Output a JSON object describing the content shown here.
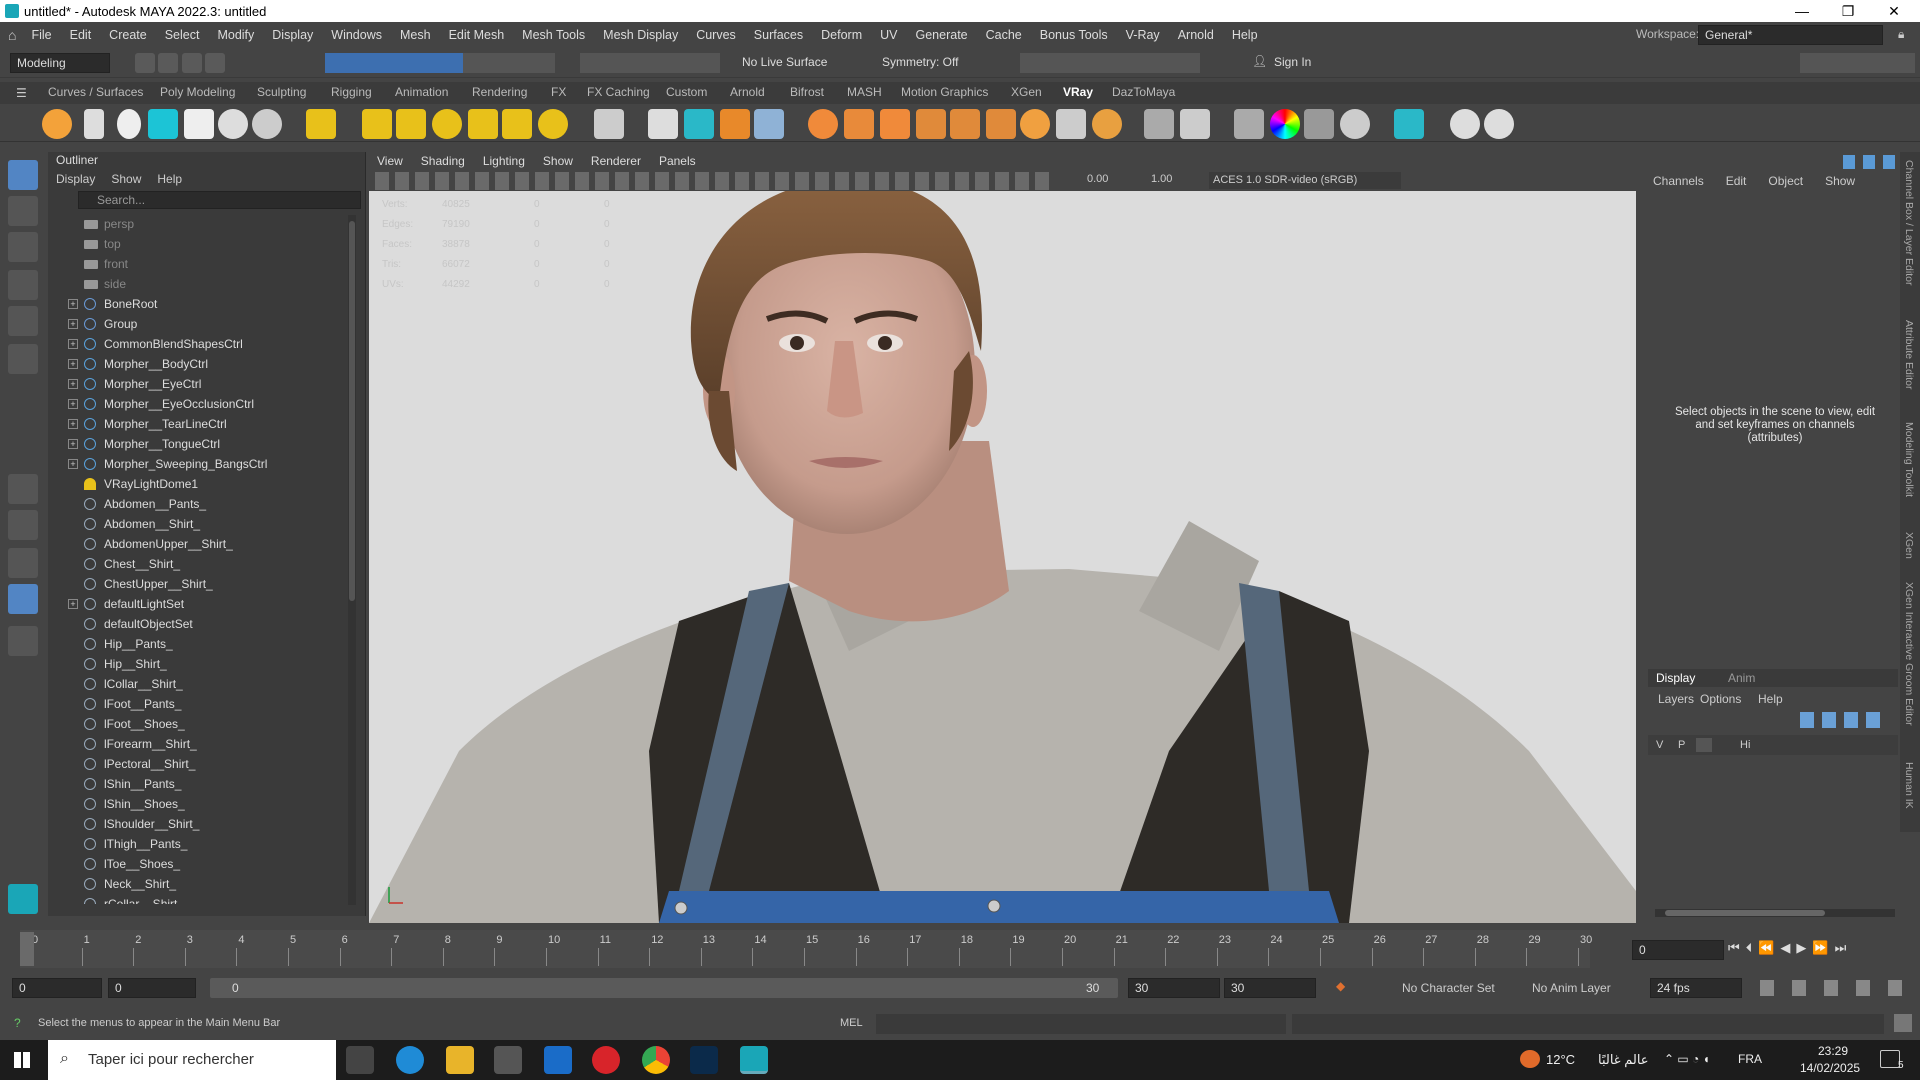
{
  "window": {
    "title": "untitled* - Autodesk MAYA 2022.3: untitled"
  },
  "menubar": {
    "items": [
      "File",
      "Edit",
      "Create",
      "Select",
      "Modify",
      "Display",
      "Windows",
      "Mesh",
      "Edit Mesh",
      "Mesh Tools",
      "Mesh Display",
      "Curves",
      "Surfaces",
      "Deform",
      "UV",
      "Generate",
      "Cache",
      "Bonus Tools",
      "V-Ray",
      "Arnold",
      "Help"
    ],
    "workspace_label": "Workspace:",
    "workspace_value": "General*"
  },
  "statusline": {
    "mode": "Modeling",
    "live_surface": "No Live Surface",
    "symmetry": "Symmetry: Off",
    "sign_in": "Sign In"
  },
  "shelf": {
    "tabs": [
      "Curves / Surfaces",
      "Poly Modeling",
      "Sculpting",
      "Rigging",
      "Animation",
      "Rendering",
      "FX",
      "FX Caching",
      "Custom",
      "Arnold",
      "Bifrost",
      "MASH",
      "Motion Graphics",
      "XGen",
      "VRay",
      "DazToMaya"
    ],
    "active_tab": "VRay"
  },
  "outliner": {
    "title": "Outliner",
    "menu": [
      "Display",
      "Show",
      "Help"
    ],
    "search_placeholder": "Search...",
    "items": [
      {
        "label": "persp",
        "type": "cam",
        "expand": ""
      },
      {
        "label": "top",
        "type": "cam",
        "expand": ""
      },
      {
        "label": "front",
        "type": "cam",
        "expand": ""
      },
      {
        "label": "side",
        "type": "cam",
        "expand": ""
      },
      {
        "label": "BoneRoot",
        "type": "joint",
        "expand": "+"
      },
      {
        "label": "Group",
        "type": "joint",
        "expand": "+"
      },
      {
        "label": "CommonBlendShapesCtrl",
        "type": "curve",
        "expand": "+"
      },
      {
        "label": "Morpher__BodyCtrl",
        "type": "curve",
        "expand": "+"
      },
      {
        "label": "Morpher__EyeCtrl",
        "type": "curve",
        "expand": "+"
      },
      {
        "label": "Morpher__EyeOcclusionCtrl",
        "type": "curve",
        "expand": "+"
      },
      {
        "label": "Morpher__TearLineCtrl",
        "type": "curve",
        "expand": "+"
      },
      {
        "label": "Morpher__TongueCtrl",
        "type": "curve",
        "expand": "+"
      },
      {
        "label": "Morpher_Sweeping_BangsCtrl",
        "type": "curve",
        "expand": "+"
      },
      {
        "label": "VRayLightDome1",
        "type": "light",
        "expand": ""
      },
      {
        "label": "Abdomen__Pants_",
        "type": "set",
        "expand": ""
      },
      {
        "label": "Abdomen__Shirt_",
        "type": "set",
        "expand": ""
      },
      {
        "label": "AbdomenUpper__Shirt_",
        "type": "set",
        "expand": ""
      },
      {
        "label": "Chest__Shirt_",
        "type": "set",
        "expand": ""
      },
      {
        "label": "ChestUpper__Shirt_",
        "type": "set",
        "expand": ""
      },
      {
        "label": "defaultLightSet",
        "type": "set",
        "expand": "+"
      },
      {
        "label": "defaultObjectSet",
        "type": "set",
        "expand": ""
      },
      {
        "label": "Hip__Pants_",
        "type": "set",
        "expand": ""
      },
      {
        "label": "Hip__Shirt_",
        "type": "set",
        "expand": ""
      },
      {
        "label": "lCollar__Shirt_",
        "type": "set",
        "expand": ""
      },
      {
        "label": "lFoot__Pants_",
        "type": "set",
        "expand": ""
      },
      {
        "label": "lFoot__Shoes_",
        "type": "set",
        "expand": ""
      },
      {
        "label": "lForearm__Shirt_",
        "type": "set",
        "expand": ""
      },
      {
        "label": "lPectoral__Shirt_",
        "type": "set",
        "expand": ""
      },
      {
        "label": "lShin__Pants_",
        "type": "set",
        "expand": ""
      },
      {
        "label": "lShin__Shoes_",
        "type": "set",
        "expand": ""
      },
      {
        "label": "lShoulder__Shirt_",
        "type": "set",
        "expand": ""
      },
      {
        "label": "lThigh__Pants_",
        "type": "set",
        "expand": ""
      },
      {
        "label": "lToe__Shoes_",
        "type": "set",
        "expand": ""
      },
      {
        "label": "Neck__Shirt_",
        "type": "set",
        "expand": ""
      },
      {
        "label": "rCollar__Shirt",
        "type": "set",
        "expand": ""
      }
    ]
  },
  "viewport": {
    "menu": [
      "View",
      "Shading",
      "Lighting",
      "Show",
      "Renderer",
      "Panels"
    ],
    "gamma": "0.00",
    "exposure": "1.00",
    "colorspace": "ACES 1.0 SDR-video (sRGB)",
    "hud": [
      {
        "label": "Verts:",
        "a": "40825",
        "b": "0",
        "c": "0"
      },
      {
        "label": "Edges:",
        "a": "79190",
        "b": "0",
        "c": "0"
      },
      {
        "label": "Faces:",
        "a": "38878",
        "b": "0",
        "c": "0"
      },
      {
        "label": "Tris:",
        "a": "66072",
        "b": "0",
        "c": "0"
      },
      {
        "label": "UVs:",
        "a": "44292",
        "b": "0",
        "c": "0"
      }
    ]
  },
  "channelbox": {
    "menu": [
      "Channels",
      "Edit",
      "Object",
      "Show"
    ],
    "hint": "Select objects in the scene to view, edit and set keyframes on channels (attributes)",
    "layer_tabs": [
      "Display",
      "Anim"
    ],
    "layer_menu": [
      "Layers",
      "Options",
      "Help"
    ],
    "layer_row": {
      "v": "V",
      "p": "P",
      "name": "Hi"
    }
  },
  "right_tabs": [
    "Channel Box / Layer Editor",
    "Attribute Editor",
    "Modeling Toolkit",
    "XGen",
    "XGen Interactive Groom Editor",
    "Human IK"
  ],
  "timeline": {
    "ticks": [
      "0",
      "1",
      "2",
      "3",
      "4",
      "5",
      "6",
      "7",
      "8",
      "9",
      "10",
      "11",
      "12",
      "13",
      "14",
      "15",
      "16",
      "17",
      "18",
      "19",
      "20",
      "21",
      "22",
      "23",
      "24",
      "25",
      "26",
      "27",
      "28",
      "29",
      "30"
    ],
    "current_frame": "0"
  },
  "range": {
    "start": "0",
    "start2": "0",
    "slider_start": "0",
    "slider_end": "30",
    "end1": "30",
    "end2": "30",
    "character_set": "No Character Set",
    "anim_layer": "No Anim Layer",
    "fps": "24 fps"
  },
  "helpline": {
    "text": "Select the menus to appear in the Main Menu Bar",
    "mel": "MEL"
  },
  "taskbar": {
    "search": "Taper ici pour rechercher",
    "weather": "12°C",
    "weather_text": "عالم غالبًا",
    "lang": "FRA",
    "time": "23:29",
    "date": "14/02/2025",
    "notif": "5"
  }
}
